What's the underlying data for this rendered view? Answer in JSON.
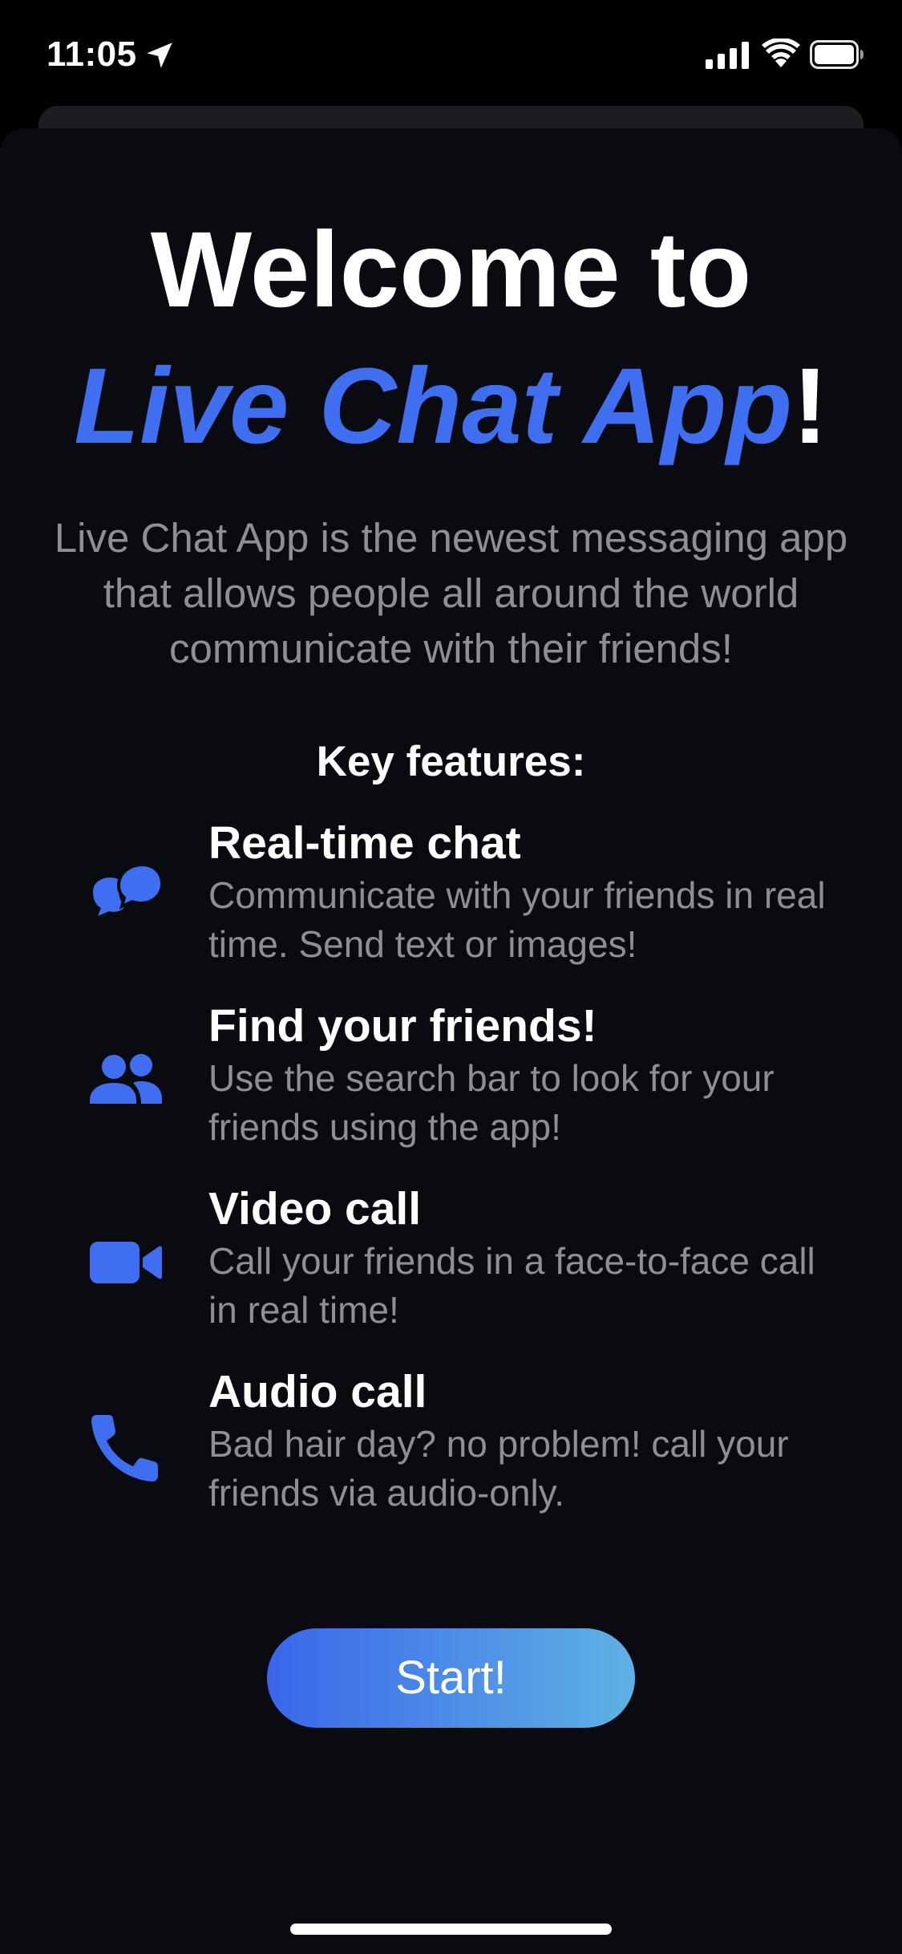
{
  "status_bar": {
    "time": "11:05",
    "icons": [
      "location-arrow-icon",
      "cellular-signal-icon",
      "wifi-icon",
      "battery-icon"
    ]
  },
  "welcome": {
    "line1": "Welcome to",
    "app_name": "Live Chat App",
    "exclamation": "!",
    "intro": "Live Chat App is the newest messaging app that allows people all around the world communicate with their friends!"
  },
  "features": {
    "heading": "Key features:",
    "items": [
      {
        "icon": "chat-bubbles-icon",
        "title": "Real-time chat",
        "description": "Communicate with your friends in real time. Send text or images!"
      },
      {
        "icon": "people-icon",
        "title": "Find your friends!",
        "description": "Use the search bar to look for your friends using the app!"
      },
      {
        "icon": "video-camera-icon",
        "title": "Video call",
        "description": "Call your friends in a face-to-face call in real time!"
      },
      {
        "icon": "phone-icon",
        "title": "Audio call",
        "description": "Bad hair day? no problem! call your friends via audio-only."
      }
    ]
  },
  "start_button": {
    "label": "Start!"
  },
  "colors": {
    "background": "#000000",
    "sheet": "#090b10",
    "accent": "#3f6ef0",
    "secondary_text": "#8e8e93",
    "button_gradient_start": "#3a66ea",
    "button_gradient_end": "#5fb2e4"
  }
}
